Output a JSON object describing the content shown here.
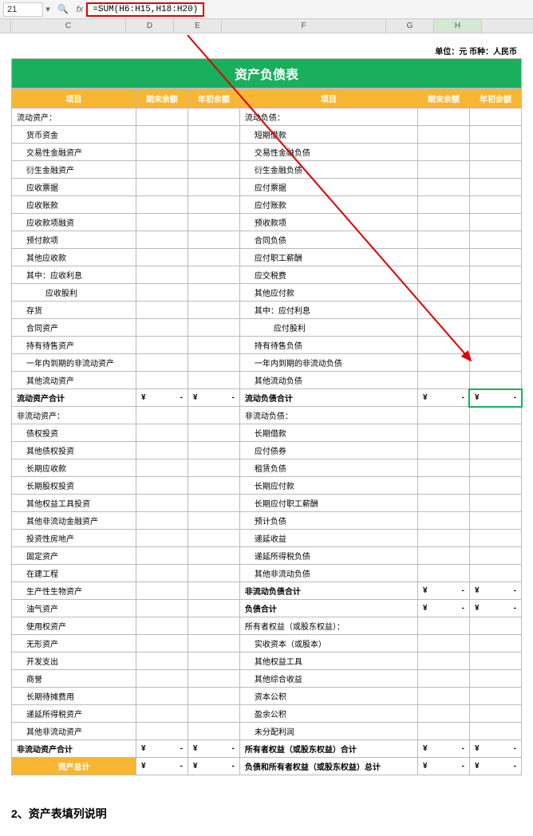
{
  "toolbar": {
    "cell_ref": "21",
    "fx": "fx",
    "formula": "=SUM(H6:H15,H18:H20)"
  },
  "columns": {
    "c": "C",
    "d": "D",
    "e": "E",
    "f": "F",
    "g": "G",
    "h": "H"
  },
  "unit_label": "单位：元  币种：人民币",
  "title": "资产负债表",
  "headers": {
    "item_l": "项目",
    "end_l": "期末余额",
    "beg_l": "年初余额",
    "item_r": "项目",
    "end_r": "期末余额",
    "beg_r": "年初余额"
  },
  "rows": [
    {
      "l": "流动资产：",
      "li": 0,
      "r": "流动负债：",
      "ri": 0
    },
    {
      "l": "货币资金",
      "li": 1,
      "r": "短期借款",
      "ri": 1
    },
    {
      "l": "交易性金融资产",
      "li": 1,
      "r": "交易性金融负债",
      "ri": 1
    },
    {
      "l": "衍生金融资产",
      "li": 1,
      "r": "衍生金融负债",
      "ri": 1
    },
    {
      "l": "应收票据",
      "li": 1,
      "r": "应付票据",
      "ri": 1
    },
    {
      "l": "应收账款",
      "li": 1,
      "r": "应付账款",
      "ri": 1
    },
    {
      "l": "应收款项融资",
      "li": 1,
      "r": "预收款项",
      "ri": 1
    },
    {
      "l": "预付款项",
      "li": 1,
      "r": "合同负债",
      "ri": 1
    },
    {
      "l": "其他应收款",
      "li": 1,
      "r": "应付职工薪酬",
      "ri": 1
    },
    {
      "l": "其中：应收利息",
      "li": 1,
      "r": "应交税费",
      "ri": 1
    },
    {
      "l": "应收股利",
      "li": 3,
      "r": "其他应付款",
      "ri": 1
    },
    {
      "l": "存货",
      "li": 1,
      "r": "其中：应付利息",
      "ri": 1
    },
    {
      "l": "合同资产",
      "li": 1,
      "r": "应付股利",
      "ri": 3
    },
    {
      "l": "持有待售资产",
      "li": 1,
      "r": "持有待售负债",
      "ri": 1
    },
    {
      "l": "一年内到期的非流动资产",
      "li": 1,
      "r": "一年内到期的非流动负债",
      "ri": 1
    },
    {
      "l": "其他流动资产",
      "li": 1,
      "r": "其他流动负债",
      "ri": 1
    },
    {
      "l": "流动资产合计",
      "li": 0,
      "bold": true,
      "lv": true,
      "r": "流动负债合计",
      "ri": 0,
      "rv": true,
      "sel": true
    },
    {
      "l": "非流动资产：",
      "li": 0,
      "r": "非流动负债：",
      "ri": 0
    },
    {
      "l": "债权投资",
      "li": 1,
      "r": "长期借款",
      "ri": 1
    },
    {
      "l": "其他债权投资",
      "li": 1,
      "r": "应付债券",
      "ri": 1
    },
    {
      "l": "长期应收款",
      "li": 1,
      "r": "租赁负债",
      "ri": 1
    },
    {
      "l": "长期股权投资",
      "li": 1,
      "r": "长期应付款",
      "ri": 1
    },
    {
      "l": "其他权益工具投资",
      "li": 1,
      "r": "长期应付职工薪酬",
      "ri": 1
    },
    {
      "l": "其他非流动金融资产",
      "li": 1,
      "r": "预计负债",
      "ri": 1
    },
    {
      "l": "投资性房地产",
      "li": 1,
      "r": "递延收益",
      "ri": 1
    },
    {
      "l": "固定资产",
      "li": 1,
      "r": "递延所得税负债",
      "ri": 1
    },
    {
      "l": "在建工程",
      "li": 1,
      "r": "其他非流动负债",
      "ri": 1
    },
    {
      "l": "生产性生物资产",
      "li": 1,
      "r": "非流动负债合计",
      "ri": 0,
      "rbold": true,
      "rv": true
    },
    {
      "l": "油气资产",
      "li": 1,
      "r": "负债合计",
      "ri": 0,
      "rbold": true,
      "rv": true
    },
    {
      "l": "使用权资产",
      "li": 1,
      "r": "所有者权益（或股东权益）：",
      "ri": 0
    },
    {
      "l": "无形资产",
      "li": 1,
      "r": "实收资本（或股本）",
      "ri": 1
    },
    {
      "l": "开发支出",
      "li": 1,
      "r": "其他权益工具",
      "ri": 1
    },
    {
      "l": "商誉",
      "li": 1,
      "r": "其他综合收益",
      "ri": 1
    },
    {
      "l": "长期待摊费用",
      "li": 1,
      "r": "资本公积",
      "ri": 1
    },
    {
      "l": "递延所得税资产",
      "li": 1,
      "r": "盈余公积",
      "ri": 1
    },
    {
      "l": "其他非流动资产",
      "li": 1,
      "r": "未分配利润",
      "ri": 1
    },
    {
      "l": "非流动资产合计",
      "li": 0,
      "bold": true,
      "lv": true,
      "r": "所有者权益（或股东权益）合计",
      "ri": 0,
      "rbold": true,
      "rv": true
    },
    {
      "l": "资产总计",
      "li": 0,
      "orange": true,
      "lv": true,
      "r": "负债和所有者权益（或股东权益）总计",
      "ri": 0,
      "rbold": true,
      "rv": true
    }
  ],
  "value": {
    "symbol": "¥",
    "dash": "-"
  },
  "footer": "2、资产表填列说明",
  "annotations": {
    "arrow_color": "#d00"
  }
}
